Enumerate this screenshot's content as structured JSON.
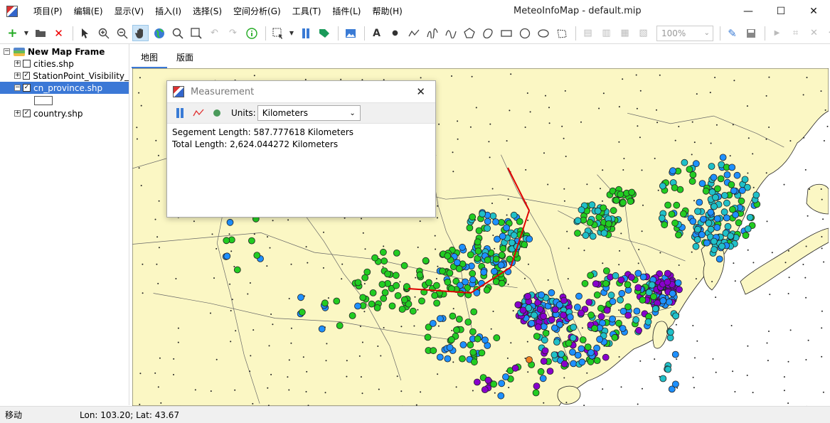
{
  "app": {
    "window_title": "MeteoInfoMap - default.mip"
  },
  "menu": [
    "项目(P)",
    "编辑(E)",
    "显示(V)",
    "插入(I)",
    "选择(S)",
    "空间分析(G)",
    "工具(T)",
    "插件(L)",
    "帮助(H)"
  ],
  "window_controls": {
    "minimize": "—",
    "maximize": "☐",
    "close": "✕"
  },
  "toolbar": {
    "zoom_value": "100%"
  },
  "layers": {
    "frame_name": "New Map Frame",
    "items": [
      {
        "name": "cities.shp",
        "checked": ""
      },
      {
        "name": "StationPoint_Visibility_",
        "checked": "✓"
      },
      {
        "name": "cn_province.shp",
        "checked": "✓"
      },
      {
        "name": "country.shp",
        "checked": "✓"
      }
    ]
  },
  "tabs": [
    "地图",
    "版面"
  ],
  "measurement": {
    "title": "Measurement",
    "close_glyph": "✕",
    "units_label": "Units:",
    "units_value": "Kilometers",
    "segment_text": "Segement Length: 587.777618 Kilometers",
    "total_text": "Total Length: 2,624.044272 Kilometers"
  },
  "status": {
    "mode": "移动",
    "coords": "Lon: 103.20; Lat: 43.67"
  },
  "colors": {
    "land": "#fbf7c4",
    "ocean": "#ffffff",
    "measure_line": "#e00000",
    "station_green": "#22cc22",
    "station_blue": "#1e90ff",
    "station_cyan": "#20c0c8",
    "station_purple": "#8800cc",
    "station_orange": "#f08020",
    "selection": "#3b78d6"
  }
}
